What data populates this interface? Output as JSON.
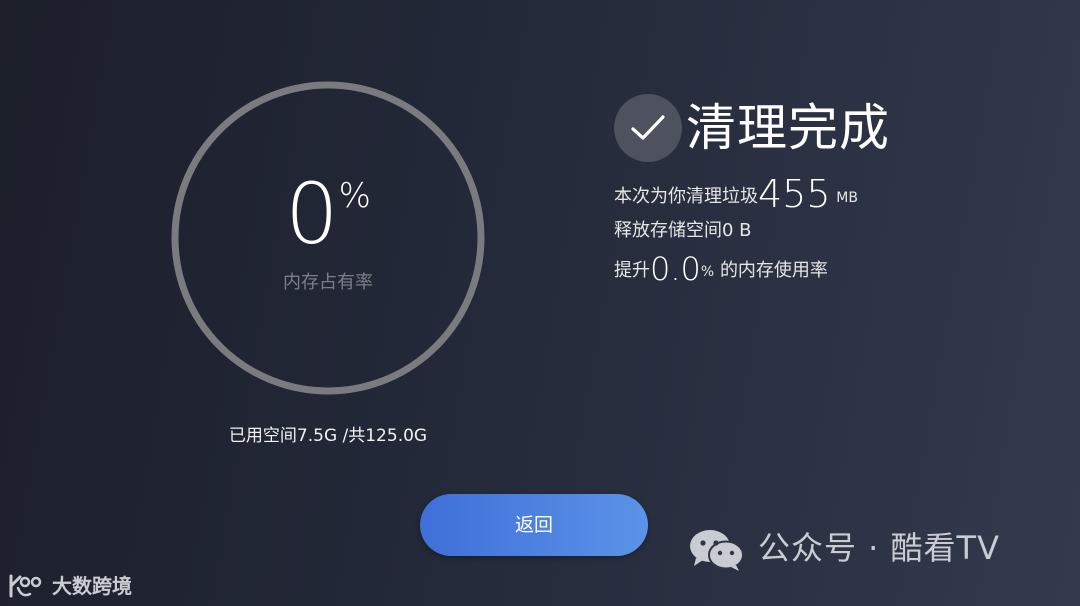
{
  "gauge": {
    "value": "0",
    "unit": "%",
    "label": "内存占有率",
    "fraction": 0
  },
  "storage": {
    "text": "已用空间7.5G  /共125.0G"
  },
  "status": {
    "icon": "checkmark-icon",
    "title": "清理完成"
  },
  "summary": {
    "cleaned_prefix": "本次为你清理垃圾",
    "cleaned_value": "455",
    "cleaned_unit": "MB",
    "freed_text": "释放存储空间0 B",
    "improve_prefix": "提升",
    "improve_value": "0.0",
    "improve_unit": "%",
    "improve_suffix": "的内存使用率"
  },
  "actions": {
    "back_label": "返回"
  },
  "watermark": {
    "wechat_text": "公众号 · 酷看TV",
    "corner_text": "大数跨境"
  },
  "colors": {
    "ring": "#7a7b7f",
    "button_start": "#3f6fd8",
    "button_end": "#5b93e8",
    "check_circle": "#4d525e"
  }
}
